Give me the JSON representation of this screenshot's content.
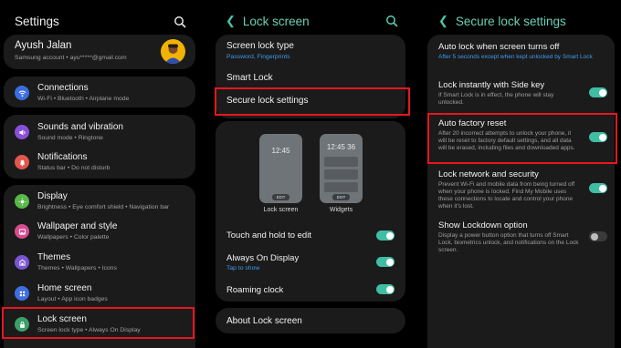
{
  "colors": {
    "background": "#000000",
    "card": "#1b1b1b",
    "accent": "#3fbea4",
    "link_blue": "#3d9bf0",
    "highlight": "#e8161e"
  },
  "settings": {
    "title": "Settings",
    "search_icon": "search-icon",
    "profile": {
      "name": "Ayush Jalan",
      "subtitle": "Samsung account  •  ayu*****@gmail.com"
    },
    "items": [
      {
        "label": "Connections",
        "sub": "Wi-Fi  •  Bluetooth  •  Airplane mode",
        "icon": "wifi-icon",
        "color": "#3b6de0"
      },
      {
        "label": "Sounds and vibration",
        "sub": "Sound mode  •  Ringtone",
        "icon": "volume-icon",
        "color": "#8a4fd8"
      },
      {
        "label": "Notifications",
        "sub": "Status bar  •  Do not disturb",
        "icon": "bell-icon",
        "color": "#e2574c"
      },
      {
        "label": "Display",
        "sub": "Brightness  •  Eye comfort shield  •  Navigation bar",
        "icon": "sun-icon",
        "color": "#59b74a"
      },
      {
        "label": "Wallpaper and style",
        "sub": "Wallpapers  •  Color palette",
        "icon": "image-icon",
        "color": "#d54c8f"
      },
      {
        "label": "Themes",
        "sub": "Themes  •  Wallpapers  •  Icons",
        "icon": "theme-icon",
        "color": "#7a55d4"
      },
      {
        "label": "Home screen",
        "sub": "Layout  •  App icon badges",
        "icon": "home-icon",
        "color": "#3e6fe2"
      },
      {
        "label": "Lock screen",
        "sub": "Screen lock type  •  Always On Display",
        "icon": "lock-icon",
        "color": "#3c9e6a"
      }
    ]
  },
  "lock_screen": {
    "back_icon": "chevron-left-icon",
    "title": "Lock screen",
    "screen_lock_type": {
      "label": "Screen lock type",
      "sub": "Password, Fingerprints"
    },
    "smart_lock": "Smart Lock",
    "secure_lock_settings": "Secure lock settings",
    "preview_lock_time": "12:45",
    "preview_widgets_time": "12:45 36",
    "edit_label": "EDIT",
    "preview_lock_caption": "Lock screen",
    "preview_widgets_caption": "Widgets",
    "touch_hold": {
      "label": "Touch and hold to edit",
      "on": true
    },
    "always_on": {
      "label": "Always On Display",
      "sub": "Tap to show",
      "on": true
    },
    "roaming": {
      "label": "Roaming clock",
      "on": true
    },
    "about": "About Lock screen"
  },
  "secure_lock": {
    "back_icon": "chevron-left-icon",
    "title": "Secure lock settings",
    "items": [
      {
        "label": "Auto lock when screen turns off",
        "desc": "After 5 seconds except when kept unlocked by Smart Lock",
        "toggle": null,
        "blue": true
      },
      {
        "label": "Lock instantly with Side key",
        "desc": "If Smart Lock is in effect, the phone will stay unlocked.",
        "toggle": true,
        "blue": false
      },
      {
        "label": "Auto factory reset",
        "desc": "After 20 incorrect attempts to unlock your phone, it will be reset to factory default settings, and all data will be erased, including files and downloaded apps.",
        "toggle": true,
        "blue": false
      },
      {
        "label": "Lock network and security",
        "desc": "Prevent Wi-Fi and mobile data from being turned off when your phone is locked. Find My Mobile uses these connections to locate and control your phone when it's lost.",
        "toggle": true,
        "blue": false
      },
      {
        "label": "Show Lockdown option",
        "desc": "Display a power button option that turns off Smart Lock, biometrics unlock, and notifications on the Lock screen.",
        "toggle": false,
        "blue": false
      }
    ]
  }
}
